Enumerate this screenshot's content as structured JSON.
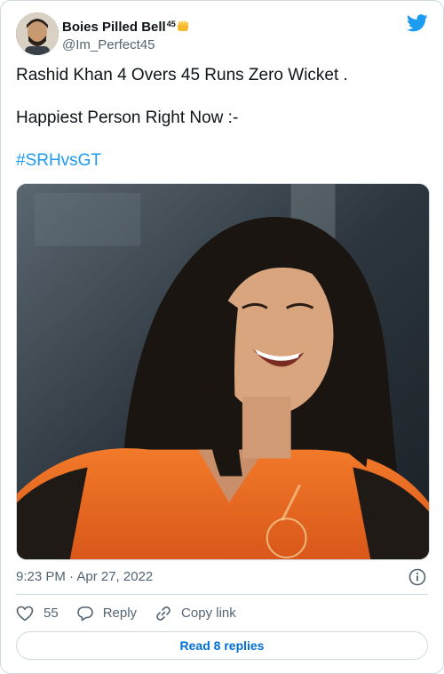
{
  "author": {
    "display_name": "Boies Pilled Bell",
    "name_superscript": "45",
    "handle": "@Im_Perfect45",
    "name_emoji_icon": "raised-fist-icon",
    "avatar_icon": "avatar"
  },
  "brand": {
    "icon": "twitter-bird-icon",
    "color": "#1d9bf0"
  },
  "tweet": {
    "line1": "Rashid Khan 4 Overs 45 Runs Zero Wicket .",
    "line2": "Happiest Person Right Now :-",
    "hashtag": "#SRHvsGT",
    "media_icon": "tweet-photo"
  },
  "meta": {
    "timestamp": "9:23 PM · Apr 27, 2022",
    "info_icon": "info-icon"
  },
  "actions": {
    "like_count": "55",
    "reply_label": "Reply",
    "copy_link_label": "Copy link"
  },
  "footer": {
    "read_replies_label": "Read 8 replies"
  },
  "colors": {
    "text": "#0f1419",
    "secondary": "#536471",
    "link": "#1d9bf0",
    "border": "#cfd9de",
    "button_text": "#006fd6"
  }
}
